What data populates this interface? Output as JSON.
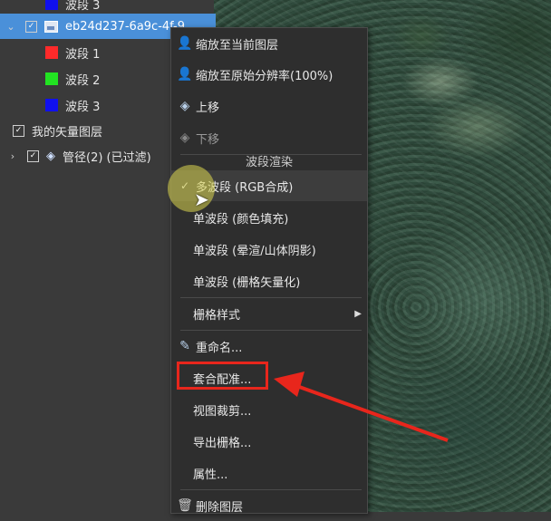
{
  "colors": {
    "accent": "#4a90d9",
    "annotation": "#e8261c",
    "band_red": "#ff2a2a",
    "band_green": "#22e322",
    "band_blue": "#1010ee"
  },
  "tree": {
    "partial_top_band": "波段 3",
    "selected_layer": "eb24d237-6a9c-4f-9",
    "bands": [
      "波段 1",
      "波段 2",
      "波段 3"
    ],
    "vector_group": "我的矢量图层",
    "vector_layer": "管径(2) (已过滤)"
  },
  "menu": {
    "zoom_to_layer": "缩放至当前图层",
    "zoom_native": "缩放至原始分辨率(100%)",
    "move_up": "上移",
    "move_down": "下移",
    "section_band_render": "波段渲染",
    "multiband": "多波段 (RGB合成)",
    "singleband_color": "单波段 (颜色填充)",
    "singleband_hillshade": "单波段 (晕渲/山体阴影)",
    "singleband_vector": "单波段 (栅格矢量化)",
    "raster_style": "栅格样式",
    "rename": "重命名...",
    "georeference": "套合配准...",
    "view_clip": "视图裁剪...",
    "export_raster": "导出栅格...",
    "properties": "属性...",
    "delete_layer": "删除图层"
  }
}
